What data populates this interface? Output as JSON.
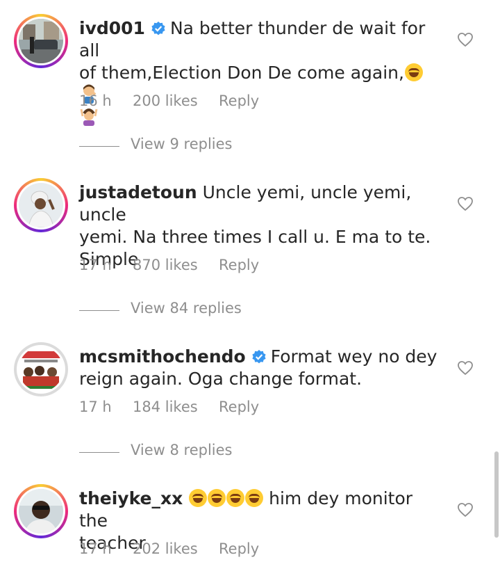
{
  "comments": [
    {
      "username": "ivd001",
      "verified": true,
      "text_line1": "Na better thunder de wait for all",
      "text_line2": "of them,Election Don De come again,",
      "emojis": [
        "face-with-tears-of-joy",
        "person-facepalming",
        "person-raising-hands"
      ],
      "time": "16 h",
      "likes": "200 likes",
      "reply_label": "Reply",
      "view_replies": "View 9 replies"
    },
    {
      "username": "justadetoun",
      "verified": false,
      "text_line1": "Uncle yemi, uncle yemi, uncle",
      "text_line2": "yemi. Na three times I call u. E ma to te.",
      "text_line3": "Simple",
      "time": "17 h",
      "likes": "870 likes",
      "reply_label": "Reply",
      "view_replies": "View 84 replies"
    },
    {
      "username": "mcsmithochendo",
      "verified": true,
      "text_line1": "Format wey no dey",
      "text_line2": "reign again. Oga change format.",
      "time": "17 h",
      "likes": "184 likes",
      "reply_label": "Reply",
      "view_replies": "View 8 replies"
    },
    {
      "username": "theiyke_xx",
      "verified": false,
      "emojis": [
        "face-with-tears-of-joy",
        "face-with-tears-of-joy",
        "face-with-tears-of-joy",
        "face-with-tears-of-joy"
      ],
      "text_line1": "him dey monitor the",
      "text_line2": "teacher",
      "time": "17 h",
      "likes": "202 likes",
      "reply_label": "Reply"
    }
  ],
  "icons": {
    "verified": "verified-badge-icon",
    "like": "heart-outline-icon"
  },
  "colors": {
    "text": "#262626",
    "meta": "#8e8e8e",
    "verified": "#3897f0"
  }
}
